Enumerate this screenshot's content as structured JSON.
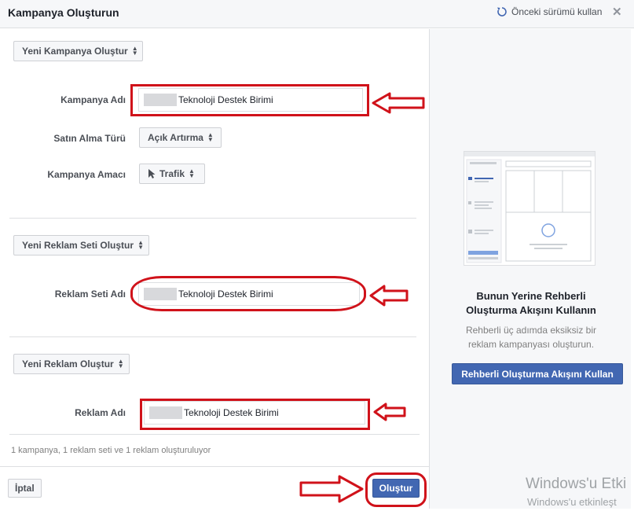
{
  "header": {
    "title": "Kampanya Oluşturun",
    "prev_version": "Önceki sürümü kullan",
    "close": "✕"
  },
  "campaign": {
    "section_button": "Yeni Kampanya Oluştur",
    "name_label": "Kampanya Adı",
    "name_value": "Teknoloji Destek Birimi",
    "buy_type_label": "Satın Alma Türü",
    "buy_type_value": "Açık Artırma",
    "objective_label": "Kampanya Amacı",
    "objective_value": "Trafik"
  },
  "adset": {
    "section_button": "Yeni Reklam Seti Oluştur",
    "name_label": "Reklam Seti Adı",
    "name_value": "Teknoloji Destek Birimi"
  },
  "ad": {
    "section_button": "Yeni Reklam Oluştur",
    "name_label": "Reklam Adı",
    "name_value": "Teknoloji Destek Birimi"
  },
  "footer": {
    "summary": "1 kampanya, 1 reklam seti ve 1 reklam oluşturuluyor",
    "cancel": "İptal",
    "create": "Oluştur"
  },
  "guided": {
    "title_line1": "Bunun Yerine Rehberli",
    "title_line2": "Oluşturma Akışını Kullanın",
    "desc_line1": "Rehberli üç adımda eksiksiz bir",
    "desc_line2": "reklam kampanyası oluşturun.",
    "button": "Rehberli Oluşturma Akışını Kullan"
  },
  "watermark": {
    "line1": "Windows'u Etki",
    "line2": "Windows'u etkinleşt"
  },
  "colors": {
    "accent": "#4267b2",
    "annotation_red": "#d0121a"
  }
}
